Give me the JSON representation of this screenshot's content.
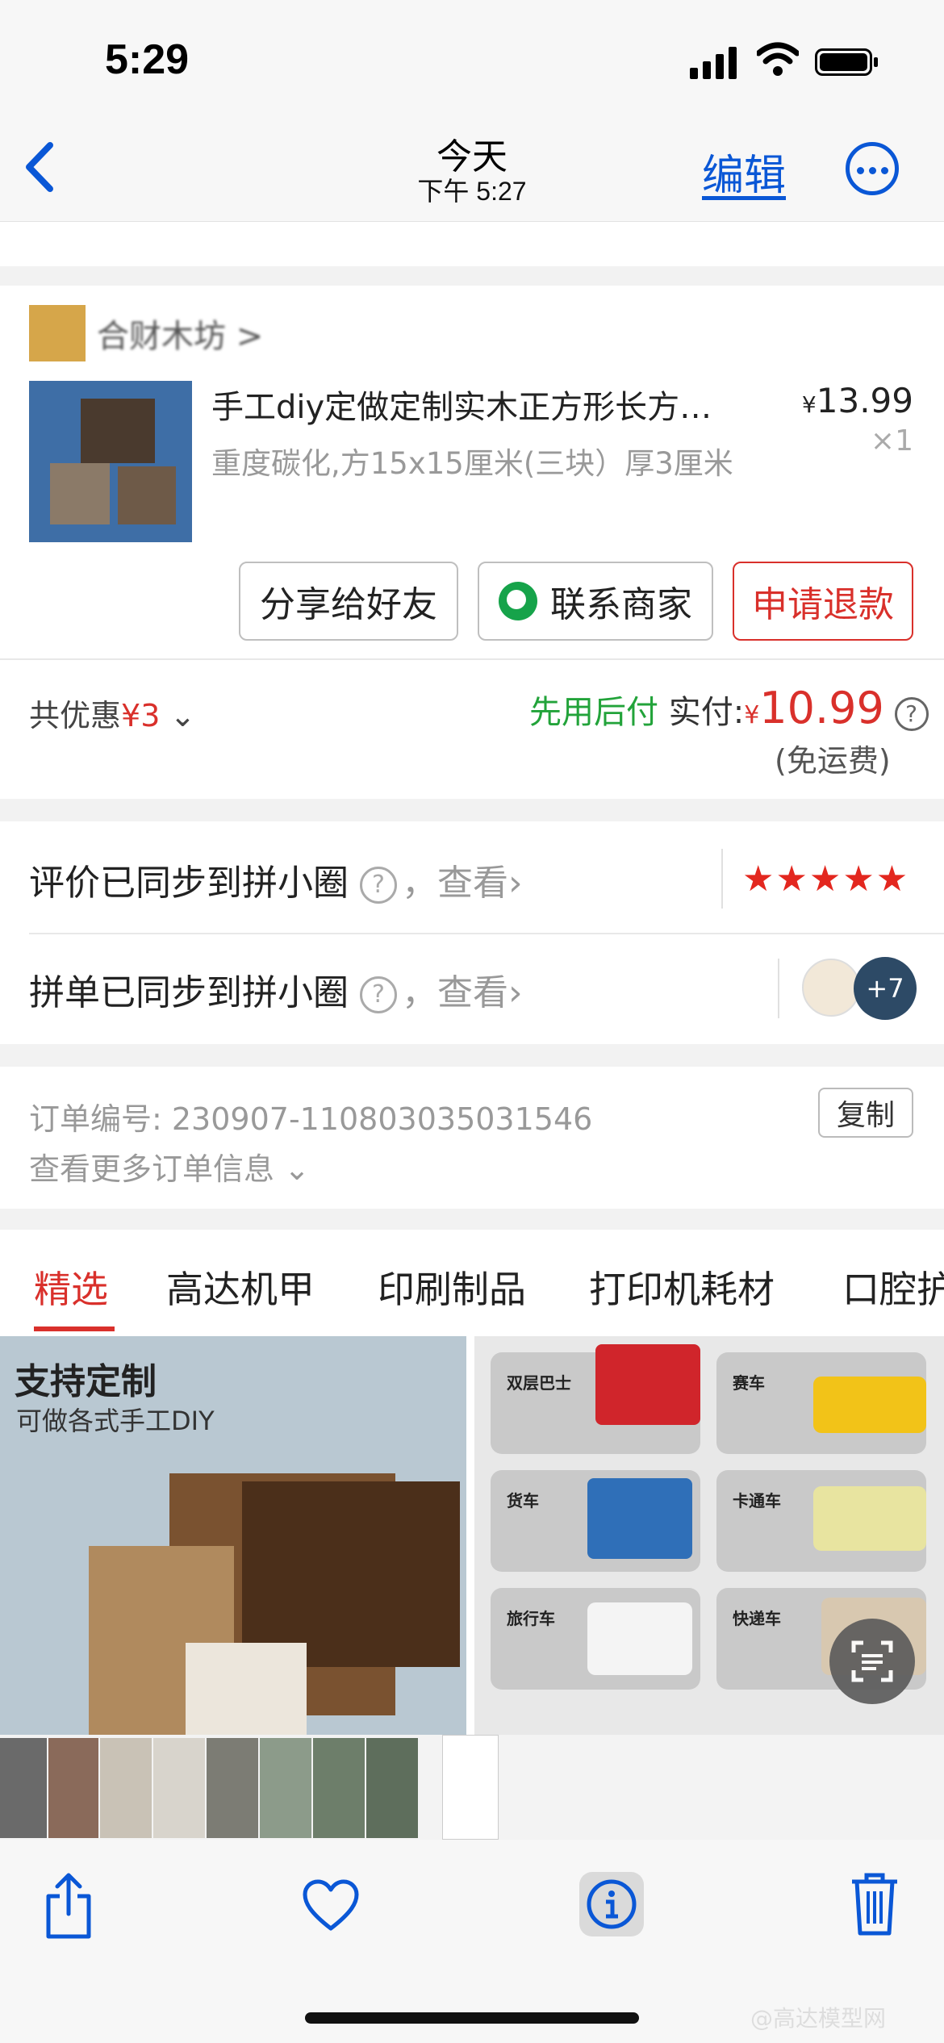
{
  "status": {
    "time": "5:29"
  },
  "nav": {
    "title": "今天",
    "subtitle": "下午 5:27",
    "edit_label": "编辑"
  },
  "shop": {
    "name": "合财木坊 >"
  },
  "item": {
    "title": "手工diy定做定制实木正方形长方…",
    "spec": "重度碳化,方15x15厘米(三块）厚3厘米",
    "price_symbol": "¥",
    "price": "13.99",
    "qty": "×1"
  },
  "actions": {
    "share": "分享给好友",
    "contact": "联系商家",
    "refund": "申请退款"
  },
  "summary": {
    "discount_label": "共优惠",
    "discount_value": "¥3",
    "pay_later": "先用后付",
    "paid_label": "实付:",
    "paid_symbol": "¥",
    "paid_value": "10.99",
    "shipping": "(免运费)"
  },
  "sync": {
    "review_text": "评价已同步到拼小圈",
    "group_text": "拼单已同步到拼小圈",
    "q": "?",
    "view_label": "，查看",
    "stars": "★★★★★",
    "more_count": "+7"
  },
  "order": {
    "number_label": "订单编号: 230907-110803035031546",
    "copy_label": "复制",
    "more_label": "查看更多订单信息"
  },
  "tabs": [
    "精选",
    "高达机甲",
    "印刷制品",
    "打印机耗材",
    "口腔护"
  ],
  "products": {
    "p1_title": "支持定制",
    "p1_sub": "可做各式手工DIY",
    "p2_labels": [
      "双层巴士",
      "赛车",
      "货车",
      "卡通车",
      "旅行车",
      "快递车"
    ]
  },
  "watermark": "@高达模型网",
  "colors": {
    "accent_blue": "#0a57d6",
    "accent_red": "#d9302b",
    "green": "#22a33a"
  }
}
